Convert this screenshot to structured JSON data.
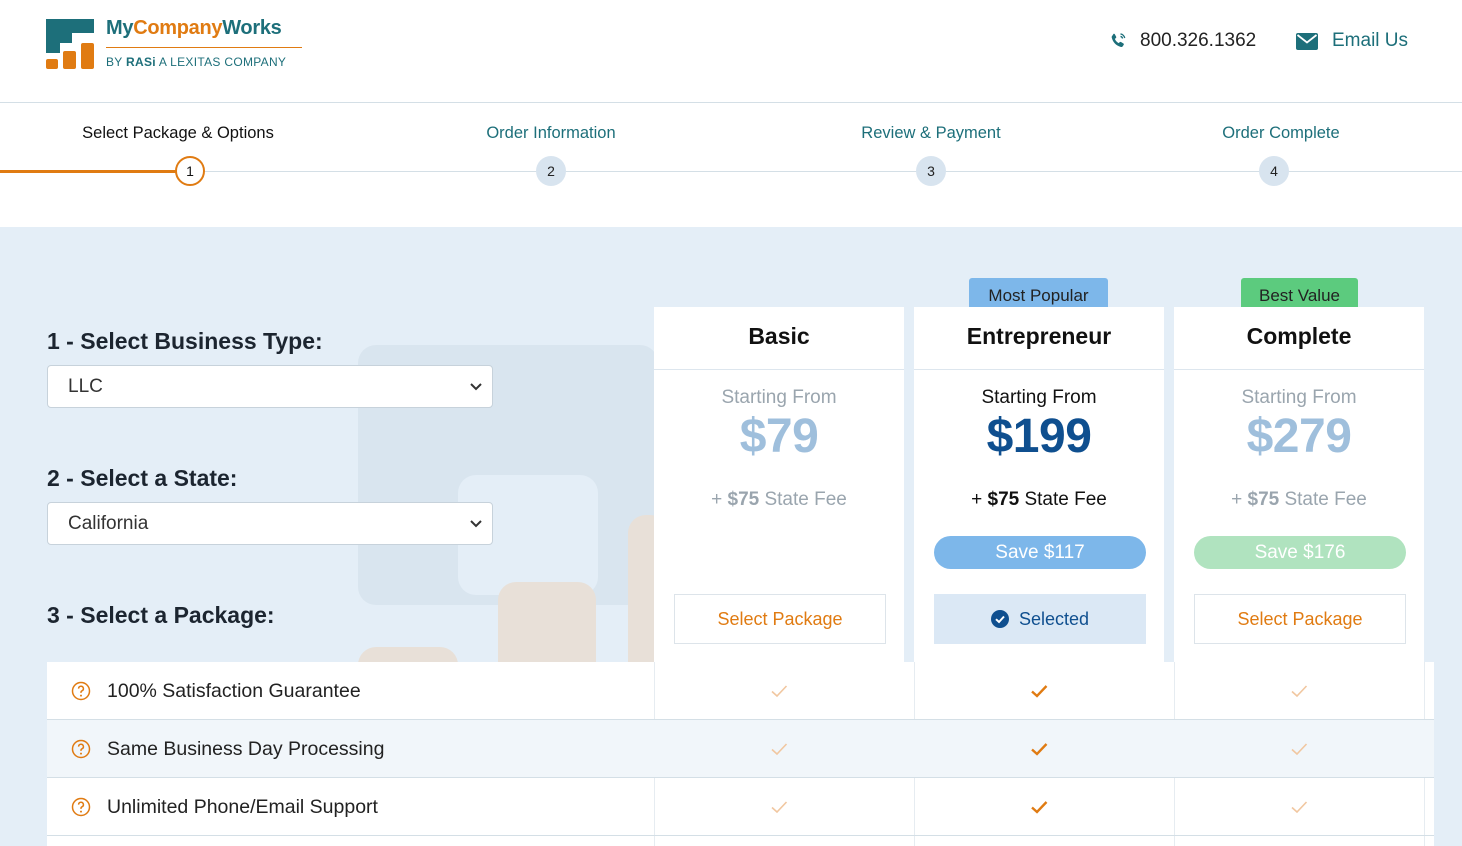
{
  "brand": {
    "name_part1": "My",
    "name_part2": "Company",
    "name_part3": "Works",
    "tagline_prefix": "BY ",
    "tagline_brand": "RASi",
    "tagline_suffix": " A LEXITAS COMPANY"
  },
  "contact": {
    "phone": "800.326.1362",
    "email_label": "Email Us"
  },
  "steps": [
    {
      "label": "Select Package & Options",
      "number": "1",
      "state": "active"
    },
    {
      "label": "Order Information",
      "number": "2",
      "state": "upcoming"
    },
    {
      "label": "Review & Payment",
      "number": "3",
      "state": "upcoming"
    },
    {
      "label": "Order Complete",
      "number": "4",
      "state": "upcoming"
    }
  ],
  "form": {
    "business_type": {
      "heading": "1 - Select Business Type:",
      "value": "LLC"
    },
    "state": {
      "heading": "2 - Select a State:",
      "value": "California"
    },
    "package_heading": "3 - Select a Package:"
  },
  "packages": [
    {
      "name": "Basic",
      "starting_label": "Starting From",
      "price": "$79",
      "fee_prefix": "+ ",
      "fee_amount": "$75",
      "fee_suffix": " State Fee",
      "save": "",
      "button": "Select Package",
      "selected": false,
      "badge": ""
    },
    {
      "name": "Entrepreneur",
      "starting_label": "Starting From",
      "price": "$199",
      "fee_prefix": "+ ",
      "fee_amount": "$75",
      "fee_suffix": " State Fee",
      "save": "Save $117",
      "button": "Selected",
      "selected": true,
      "badge": "Most Popular"
    },
    {
      "name": "Complete",
      "starting_label": "Starting From",
      "price": "$279",
      "fee_prefix": "+ ",
      "fee_amount": "$75",
      "fee_suffix": " State Fee",
      "save": "Save $176",
      "button": "Select Package",
      "selected": false,
      "badge": "Best Value"
    }
  ],
  "features": [
    {
      "label": "100% Satisfaction Guarantee",
      "included": [
        true,
        true,
        true
      ]
    },
    {
      "label": "Same Business Day Processing",
      "included": [
        true,
        true,
        true
      ]
    },
    {
      "label": "Unlimited Phone/Email Support",
      "included": [
        true,
        true,
        true
      ]
    }
  ],
  "colors": {
    "brand_teal": "#1d6f7a",
    "brand_orange": "#e07b12",
    "price_selected": "#0f4f8f",
    "price_muted": "#9fbfdc",
    "badge_popular": "#7db7ea",
    "badge_value": "#5ccb7e",
    "save_selected": "#7db7ea",
    "save_muted": "#b0e3bf",
    "background": "#e4eef7"
  }
}
